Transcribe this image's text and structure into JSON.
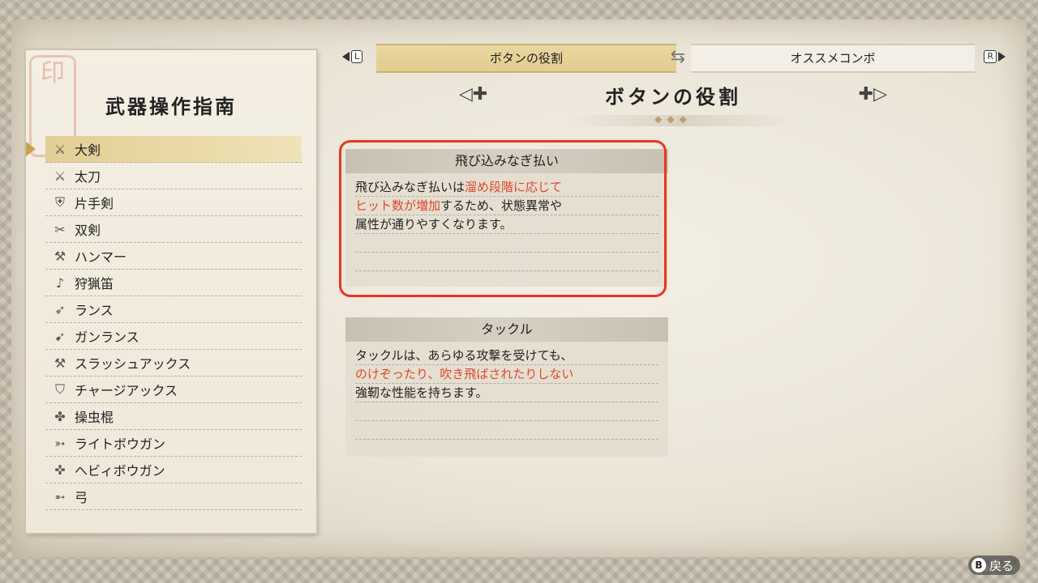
{
  "tabs": {
    "left_key": "L",
    "right_key": "R",
    "active_label": "ボタンの役割",
    "inactive_label": "オススメコンボ"
  },
  "section": {
    "title": "ボタンの役割"
  },
  "left_panel": {
    "title": "武器操作指南",
    "items": [
      {
        "label": "大剣",
        "icon": "great-sword-icon"
      },
      {
        "label": "太刀",
        "icon": "long-sword-icon"
      },
      {
        "label": "片手剣",
        "icon": "sword-and-shield-icon"
      },
      {
        "label": "双剣",
        "icon": "dual-blades-icon"
      },
      {
        "label": "ハンマー",
        "icon": "hammer-icon"
      },
      {
        "label": "狩猟笛",
        "icon": "hunting-horn-icon"
      },
      {
        "label": "ランス",
        "icon": "lance-icon"
      },
      {
        "label": "ガンランス",
        "icon": "gunlance-icon"
      },
      {
        "label": "スラッシュアックス",
        "icon": "switch-axe-icon"
      },
      {
        "label": "チャージアックス",
        "icon": "charge-blade-icon"
      },
      {
        "label": "操虫棍",
        "icon": "insect-glaive-icon"
      },
      {
        "label": "ライトボウガン",
        "icon": "light-bowgun-icon"
      },
      {
        "label": "ヘビィボウガン",
        "icon": "heavy-bowgun-icon"
      },
      {
        "label": "弓",
        "icon": "bow-icon"
      }
    ],
    "selected_index": 0
  },
  "cards": [
    {
      "title": "飛び込みなぎ払い",
      "line1_a": "飛び込みなぎ払いは",
      "line1_b": "溜め段階に応じて",
      "line2_a": "ヒット数が増加",
      "line2_b": "するため、状態異常や",
      "line3": "属性が通りやすくなります。"
    },
    {
      "title": "タックル",
      "line1": "タックルは、あらゆる攻撃を受けても、",
      "line2": "のけぞったり、吹き飛ばされたりしない",
      "line3": "強靭な性能を持ちます。"
    }
  ],
  "footer": {
    "button": "B",
    "label": "戻る"
  },
  "colors": {
    "highlight_text": "#e0462a",
    "highlight_box": "#e8361e",
    "selected_row": "#e2cf94"
  }
}
